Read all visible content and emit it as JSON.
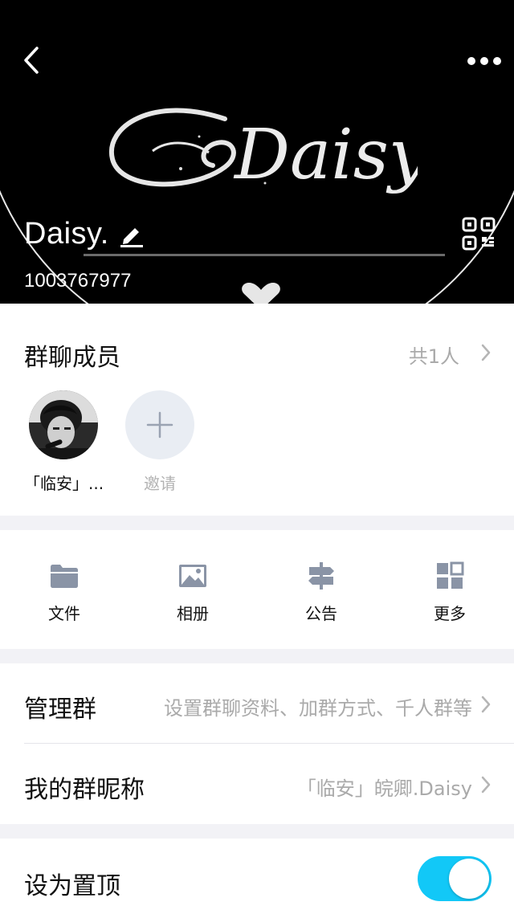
{
  "header": {
    "group_name": "Daisy.",
    "group_id": "1003767977",
    "banner_text": "Daisy"
  },
  "members": {
    "title": "群聊成员",
    "count": "共1人",
    "items": [
      {
        "label": "「临安」..."
      }
    ],
    "invite_label": "邀请"
  },
  "tools": [
    {
      "label": "文件",
      "icon": "folder-icon"
    },
    {
      "label": "相册",
      "icon": "image-icon"
    },
    {
      "label": "公告",
      "icon": "signpost-icon"
    },
    {
      "label": "更多",
      "icon": "grid-icon"
    }
  ],
  "settings": {
    "manage": {
      "title": "管理群",
      "value": "设置群聊资料、加群方式、千人群等"
    },
    "nickname": {
      "title": "我的群昵称",
      "value": "「临安」皖卿.Daisy"
    },
    "pin": {
      "title": "设为置顶",
      "enabled": true
    }
  },
  "colors": {
    "accent": "#12c8f7",
    "icon_gray": "#8a94a6",
    "muted_text": "#aaaaaa",
    "section_gap": "#f2f2f6"
  }
}
